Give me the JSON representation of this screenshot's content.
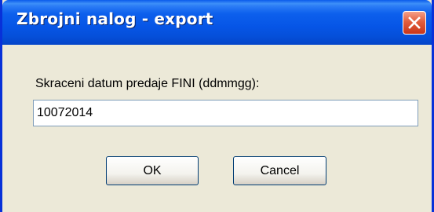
{
  "window": {
    "title": "Zbrojni nalog - export"
  },
  "dialog": {
    "prompt_label": "Skraceni datum predaje FINI (ddmmgg):",
    "date_input_value": "10072014"
  },
  "buttons": {
    "ok_label": "OK",
    "cancel_label": "Cancel"
  },
  "icons": {
    "close": "close-icon"
  },
  "colors": {
    "titlebar": "#0055e5",
    "frame_border": "#0831d9",
    "dialog_background": "#ece9d8",
    "close_button": "#e25d3c",
    "input_border": "#7f9db9",
    "button_border": "#003c74"
  }
}
